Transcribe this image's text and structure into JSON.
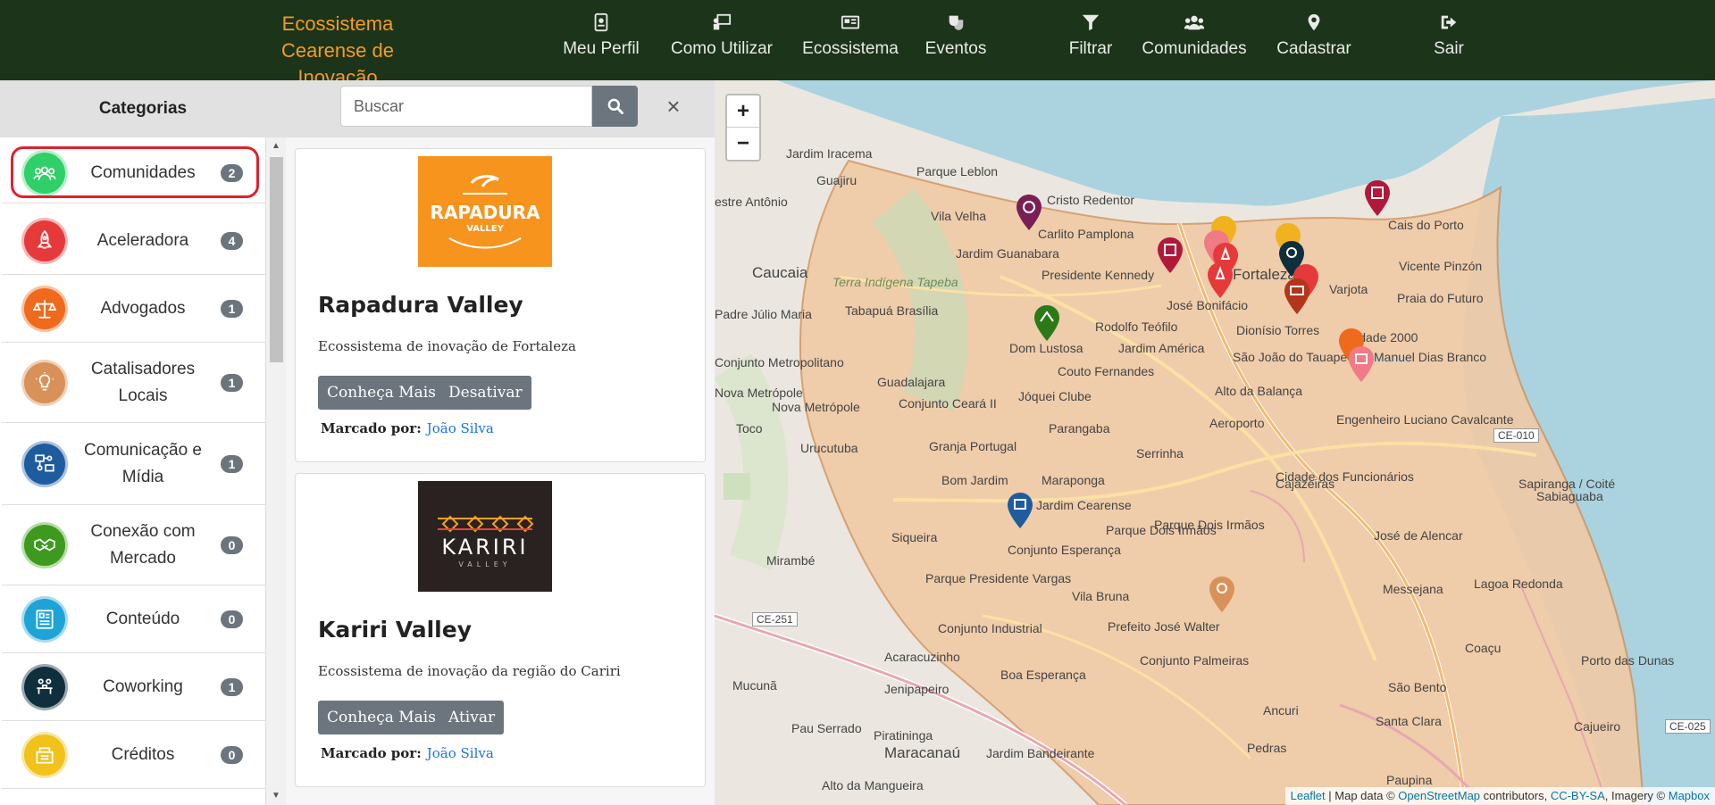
{
  "brand": {
    "line1": "Ecossistema",
    "line2": "Cearense de Inovação"
  },
  "nav": [
    {
      "label": "Meu Perfil",
      "icon": "id-badge-icon"
    },
    {
      "label": "Como Utilizar",
      "icon": "presentation-icon"
    },
    {
      "label": "Ecossistema",
      "icon": "newspaper-icon"
    },
    {
      "label": "Eventos",
      "icon": "theater-masks-icon"
    },
    {
      "label": "Filtrar",
      "icon": "filter-icon"
    },
    {
      "label": "Comunidades",
      "icon": "users-icon"
    },
    {
      "label": "Cadastrar",
      "icon": "map-marker-icon"
    },
    {
      "label": "Sair",
      "icon": "sign-out-icon"
    }
  ],
  "sidebar": {
    "title": "Categorias",
    "items": [
      {
        "label": "Comunidades",
        "count": "2",
        "color": "#2fd067",
        "icon": "users-icon",
        "selected": true
      },
      {
        "label": "Aceleradora",
        "count": "4",
        "color": "#e63a3a",
        "icon": "rocket-icon"
      },
      {
        "label": "Advogados",
        "count": "1",
        "color": "#ef6a1c",
        "icon": "scales-icon"
      },
      {
        "label": "Catalisadores Locais",
        "count": "1",
        "color": "#d9915a",
        "icon": "lightbulb-icon"
      },
      {
        "label": "Comunicação e Mídia",
        "count": "1",
        "color": "#1f5c9e",
        "icon": "media-icon"
      },
      {
        "label": "Conexão com Mercado",
        "count": "0",
        "color": "#3e9a1e",
        "icon": "handshake-icon"
      },
      {
        "label": "Conteúdo",
        "count": "0",
        "color": "#1ea3d6",
        "icon": "document-icon"
      },
      {
        "label": "Coworking",
        "count": "1",
        "color": "#0f2f3c",
        "icon": "coworking-icon"
      },
      {
        "label": "Créditos",
        "count": "0",
        "color": "#f0c21a",
        "icon": "coins-icon"
      }
    ]
  },
  "search": {
    "placeholder": "Buscar",
    "close": "×"
  },
  "cards": [
    {
      "title": "Rapadura Valley",
      "description": "Ecossistema de inovação de Fortaleza",
      "btn_more": "Conheça Mais",
      "btn_toggle": "Desativar",
      "marked_label": "Marcado por:",
      "marked_by": "João Silva",
      "logo_text": "RAPADURA",
      "logo_sub": "VALLEY",
      "logo_color": "#f7941d"
    },
    {
      "title": "Kariri Valley",
      "description": "Ecossistema de inovação da região do Cariri",
      "btn_more": "Conheça Mais",
      "btn_toggle": "Ativar",
      "marked_label": "Marcado por:",
      "marked_by": "João Silva",
      "logo_text": "KARIRI",
      "logo_sub": "VALLEY",
      "logo_color": "#2a2221"
    }
  ],
  "map": {
    "zoom_in": "+",
    "zoom_out": "−",
    "attr_leaflet": "Leaflet",
    "attr_mid": " | Map data © ",
    "attr_osm": "OpenStreetMap",
    "attr_contrib": " contributors, ",
    "attr_cc": "CC-BY-SA",
    "attr_imagery": ", Imagery © ",
    "attr_mapbox": "Mapbox",
    "labels": [
      "Jardim Iracema",
      "Parque Leblon",
      "Guajiru",
      "Cristo Redentor",
      "Vila Velha",
      "Carlito Pamplona",
      "Jardim Guanabara",
      "Presidente Kennedy",
      "Caucaia",
      "Terra Indígena Tapeba",
      "Tabapuá Brasília",
      "Padre Júlio Maria",
      "Conjunto Metropolitano",
      "Rodolfo Teófilo",
      "Dom Lustosa",
      "Jardim América",
      "Couto Fernandes",
      "Guadalajara",
      "Conjunto Ceará II",
      "Jóquei Clube",
      "Nova Metrópole",
      "Urucutuba",
      "Parangaba",
      "Aeroporto",
      "Granja Portugal",
      "Serrinha",
      "Bom Jardim",
      "Maraponga",
      "Jardim Cearense",
      "Siqueira",
      "Conjunto Esperança",
      "Parque Dois Irmãos",
      "Mirambé",
      "Parque Presidente Vargas",
      "Vila Bruna",
      "Conjunto Industrial",
      "Prefeito José Walter",
      "Conjunto Palmeiras",
      "Acaracuzinho",
      "Jenipapeiro",
      "Boa Esperança",
      "Pau Serrado",
      "Piratininga",
      "Maracanaú",
      "Jardim Bandeirante",
      "Alto da Mangueira",
      "Mucunã",
      "Messejana",
      "Lagoa Redonda",
      "Coaçu",
      "São Bento",
      "Ancuri",
      "Santa Clara",
      "Pedras",
      "Paupina",
      "José de Alencar",
      "Sabiaguaba",
      "Sapiranga / Coité",
      "Cidade dos Funcionários",
      "Cajazeiras",
      "Engenheiro Luciano Cavalcante",
      "Alto da Balança",
      "São João do Tauape",
      "Dionísio Torres",
      "José Bonifácio",
      "Varjota",
      "Praia do Futuro",
      "Vicente Pinzón",
      "Cais do Porto",
      "Manuel Dias Branco",
      "Cidade 2000",
      "Parque Dois Irmãos",
      "Porto das Dunas",
      "Fortaleza",
      "Cajueiro",
      "CE-010",
      "CE-251",
      "CE-025",
      "Toco",
      "Nova Metrópole",
      "estre Antônio"
    ]
  }
}
